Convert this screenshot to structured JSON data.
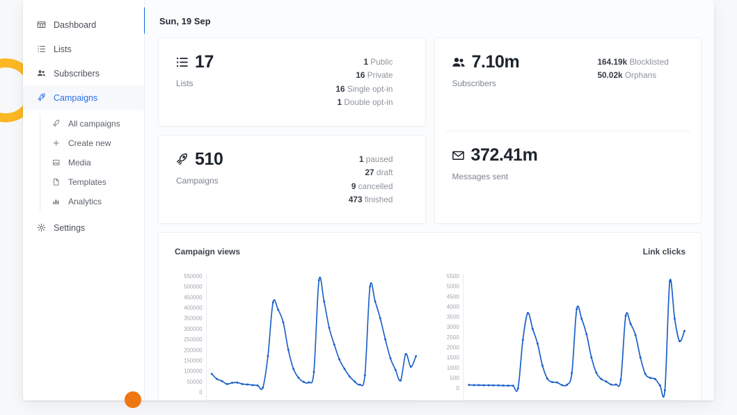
{
  "window": {
    "sidebar": {
      "items": [
        {
          "id": "dashboard",
          "label": "Dashboard",
          "icon": "dashboard-icon"
        },
        {
          "id": "lists",
          "label": "Lists",
          "icon": "list-icon"
        },
        {
          "id": "subscribers",
          "label": "Subscribers",
          "icon": "users-icon"
        },
        {
          "id": "campaigns",
          "label": "Campaigns",
          "icon": "rocket-icon",
          "active": true
        }
      ],
      "subitems": [
        {
          "id": "all-campaigns",
          "label": "All campaigns",
          "icon": "rocket-icon"
        },
        {
          "id": "create-new",
          "label": "Create new",
          "icon": "plus-icon"
        },
        {
          "id": "media",
          "label": "Media",
          "icon": "image-icon"
        },
        {
          "id": "templates",
          "label": "Templates",
          "icon": "file-icon"
        },
        {
          "id": "analytics",
          "label": "Analytics",
          "icon": "bar-chart-icon"
        }
      ],
      "settings": {
        "id": "settings",
        "label": "Settings",
        "icon": "gear-icon"
      },
      "accent_color": "#2c6ee8",
      "scroll_thumb_color": "#0d63d6"
    },
    "main": {
      "date": "Sun, 19 Sep",
      "cards": {
        "lists": {
          "value": "17",
          "label": "Lists",
          "icon": "list-icon",
          "breakdown": [
            {
              "count": "1",
              "label": "Public"
            },
            {
              "count": "16",
              "label": "Private"
            },
            {
              "count": "16",
              "label": "Single opt-in"
            },
            {
              "count": "1",
              "label": "Double opt-in"
            }
          ]
        },
        "campaigns": {
          "value": "510",
          "label": "Campaigns",
          "icon": "rocket-icon",
          "breakdown": [
            {
              "count": "1",
              "label": "paused"
            },
            {
              "count": "27",
              "label": "draft"
            },
            {
              "count": "9",
              "label": "cancelled"
            },
            {
              "count": "473",
              "label": "finished"
            }
          ]
        },
        "subscribers": {
          "value": "7.10m",
          "label": "Subscribers",
          "icon": "users-icon",
          "breakdown": [
            {
              "count": "164.19k",
              "label": "Blocklisted"
            },
            {
              "count": "50.02k",
              "label": "Orphans"
            }
          ]
        },
        "messages": {
          "value": "372.41m",
          "label": "Messages sent",
          "icon": "envelope-icon",
          "breakdown": []
        }
      }
    }
  },
  "chart_data": [
    {
      "type": "line",
      "title": "Campaign views",
      "xlabel": "",
      "ylabel": "",
      "ylim": [
        0,
        550000
      ],
      "yticks": [
        550000,
        500000,
        450000,
        400000,
        350000,
        300000,
        250000,
        200000,
        150000,
        100000,
        50000,
        0
      ],
      "grid": false,
      "legend": "none",
      "series_color": "#1a5fc8",
      "x": [
        1,
        2,
        3,
        4,
        5,
        6,
        7,
        8,
        9,
        10,
        11,
        12,
        13,
        14,
        15,
        16,
        17,
        18,
        19,
        20,
        21,
        22,
        23,
        24,
        25,
        26,
        27,
        28,
        29,
        30,
        31,
        32,
        33,
        34,
        35,
        36,
        37,
        38,
        39,
        40
      ],
      "values": [
        86000,
        62000,
        52000,
        38000,
        44000,
        45000,
        38000,
        36000,
        33000,
        31000,
        21000,
        170000,
        425000,
        390000,
        330000,
        200000,
        110000,
        68000,
        48000,
        46000,
        95000,
        530000,
        430000,
        305000,
        225000,
        155000,
        110000,
        74000,
        50000,
        35000,
        80000,
        500000,
        430000,
        350000,
        250000,
        160000,
        105000,
        55000,
        180000,
        120000,
        170000
      ]
    },
    {
      "type": "line",
      "title": "Link clicks",
      "xlabel": "",
      "ylabel": "",
      "ylim": [
        -200,
        5500
      ],
      "yticks": [
        5500,
        5000,
        4500,
        4000,
        3500,
        3000,
        2500,
        2000,
        1500,
        1000,
        500,
        0
      ],
      "grid": false,
      "legend": "none",
      "series_color": "#1a5fc8",
      "x": [
        1,
        2,
        3,
        4,
        5,
        6,
        7,
        8,
        9,
        10,
        11,
        12,
        13,
        14,
        15,
        16,
        17,
        18,
        19,
        20,
        21,
        22,
        23,
        24,
        25,
        26,
        27,
        28,
        29,
        30,
        31,
        32,
        33,
        34,
        35,
        36,
        37,
        38,
        39,
        40
      ],
      "values": [
        150,
        140,
        140,
        135,
        135,
        130,
        130,
        120,
        115,
        110,
        -20,
        2370,
        3680,
        2900,
        2180,
        1100,
        460,
        290,
        270,
        140,
        160,
        730,
        3880,
        3400,
        2640,
        1500,
        750,
        440,
        320,
        170,
        170,
        400,
        3540,
        3150,
        2600,
        1500,
        690,
        500,
        440,
        130,
        -110,
        5230,
        3400,
        2300,
        2800
      ]
    }
  ]
}
